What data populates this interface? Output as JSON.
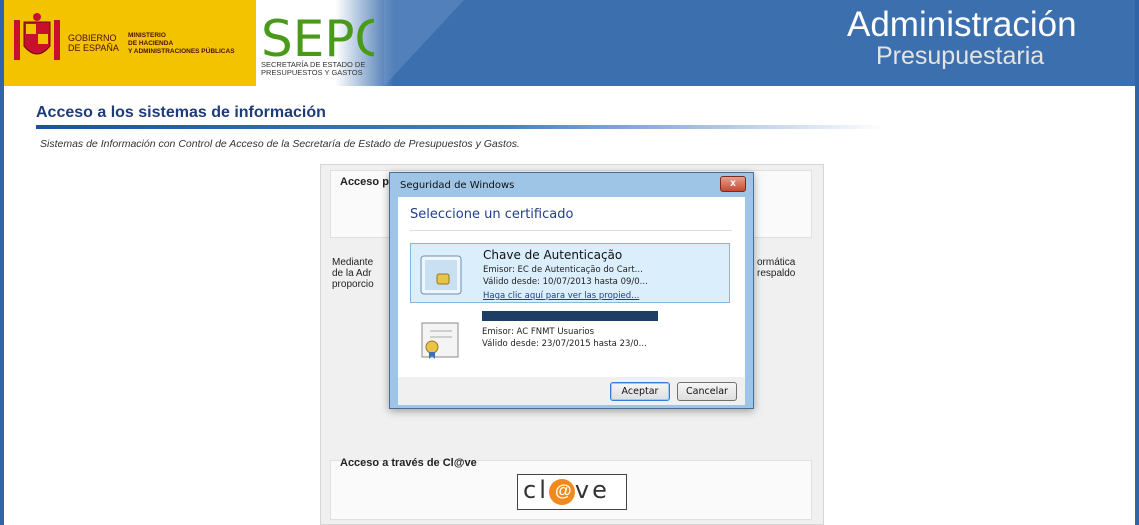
{
  "header": {
    "gov_text": [
      "GOBIERNO",
      "DE ESPAÑA"
    ],
    "ministry_text": [
      "MINISTERIO",
      "DE HACIENDA",
      "Y ADMINISTRACIONES PÚBLICAS"
    ],
    "sepg_logo": "SEPG",
    "sepg_sub": [
      "SECRETARÍA DE ESTADO DE",
      "PRESUPUESTOS Y GASTOS"
    ],
    "title": "Administración",
    "subtitle": "Presupuestaria"
  },
  "page": {
    "title": "Acceso a los sistemas de información",
    "subtitle": "Sistemas de Información con Control de Acceso de la Secretaría de Estado de Presupuestos y Gastos.",
    "box1_label": "Acceso po",
    "para_left": [
      "Mediante",
      "de la Adr",
      "proporcio"
    ],
    "para_right": [
      "ormática",
      "respaldo"
    ],
    "box2_label": "Acceso a través de Cl@ve",
    "clave_left": "cl",
    "clave_at": "@",
    "clave_right": "ve"
  },
  "dialog": {
    "title": "Seguridad de Windows",
    "close": "x",
    "heading": "Seleccione un certificado",
    "certs": [
      {
        "name": "Chave de Autenticação",
        "issuer": "Emisor: EC de Autenticação do Cart...",
        "valid": "Válido desde: 10/07/2013 hasta 09/0...",
        "link": "Haga clic aquí para ver las propied..."
      },
      {
        "name": "",
        "issuer": "Emisor: AC FNMT Usuarios",
        "valid": "Válido desde: 23/07/2015 hasta 23/0..."
      }
    ],
    "accept_label": "Aceptar",
    "cancel_label": "Cancelar"
  },
  "colors": {
    "header_blue": "#3c6fae",
    "gov_yellow": "#f3c300",
    "title_blue": "#1e3c78",
    "clave_orange": "#f08a1e"
  }
}
